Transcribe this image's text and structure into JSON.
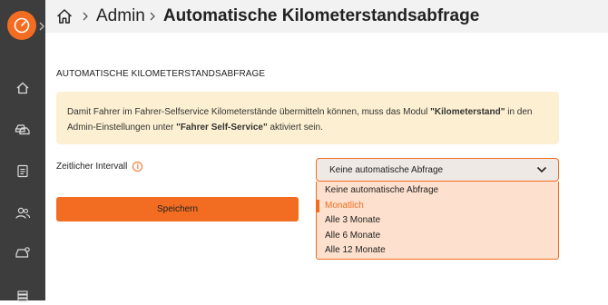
{
  "sidebar": {
    "logo_icon": "gauge-logo-icon",
    "expand_icon": "chevron-right-icon",
    "items": [
      {
        "icon": "home-icon"
      },
      {
        "icon": "cars-icon"
      },
      {
        "icon": "clipboard-icon"
      },
      {
        "icon": "users-icon"
      },
      {
        "icon": "car-settings-icon"
      },
      {
        "icon": "stack-icon"
      }
    ]
  },
  "header": {
    "home_icon": "home-icon",
    "breadcrumb": [
      "Admin",
      "Automatische Kilometerstandsabfrage"
    ]
  },
  "main": {
    "section_title": "AUTOMATISCHE KILOMETERSTANDSABFRAGE",
    "info": {
      "part1": "Damit Fahrer im Fahrer-Selfservice Kilometerstände übermitteln können, muss das Modul ",
      "bold1": "\"Kilometerstand\"",
      "part2": " in den Admin-Einstellungen unter ",
      "bold2": "\"Fahrer Self-Service\"",
      "part3": " aktiviert sein."
    },
    "interval_label": "Zeitlicher Intervall",
    "info_icon_glyph": "i",
    "save_label": "Speichern",
    "select_value": "Keine automatische Abfrage",
    "options": [
      "Keine automatische Abfrage",
      "Monatlich",
      "Alle 3 Monate",
      "Alle 6 Monate",
      "Alle 12 Monate"
    ],
    "highlighted_option_index": 1
  },
  "colors": {
    "accent": "#f26d21",
    "sidebar_bg": "#3d3d3d",
    "info_bg": "#fdf0d2",
    "dropdown_bg": "#fde0cd"
  }
}
